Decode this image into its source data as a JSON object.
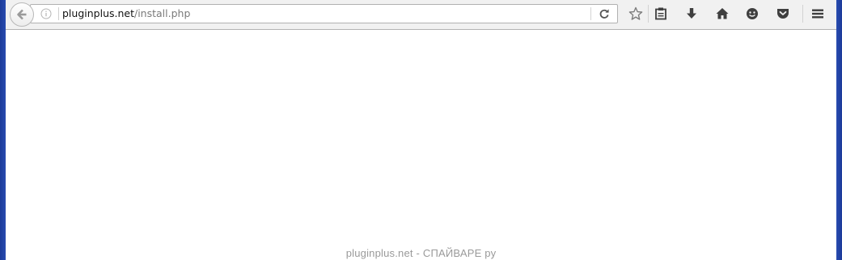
{
  "address_bar": {
    "domain": "pluginplus.net",
    "path": "/install.php"
  },
  "toolbar": {
    "icons": [
      "back-arrow-icon",
      "info-icon",
      "reload-icon",
      "bookmark-star-icon",
      "reading-list-icon",
      "download-icon",
      "home-icon",
      "hello-icon",
      "pocket-icon",
      "menu-icon"
    ]
  },
  "watermark": {
    "text": "pluginplus.net - СПАЙВАРЕ ру"
  },
  "colors": {
    "desktop": "#2a4db3",
    "toolbar": "#f1f1f1",
    "icon": "#4a4a4a",
    "icon_disabled": "#9a9a9a",
    "watermark": "#9a9a9a"
  }
}
